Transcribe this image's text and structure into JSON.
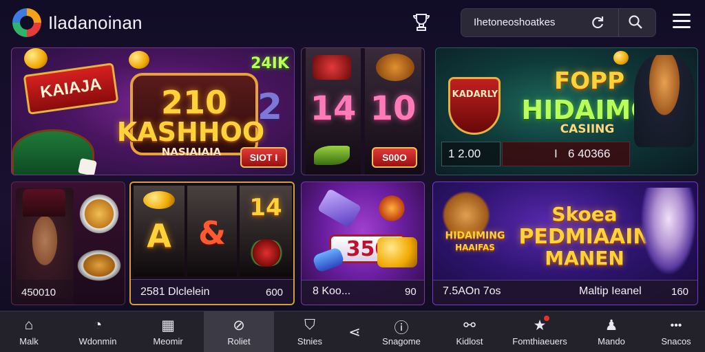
{
  "header": {
    "brand": "Iladanoinan",
    "logo_icon": "brand-logo",
    "trophy_icon": "trophy-icon",
    "search": {
      "value": "Ihetoneoshoatkes",
      "refresh_icon": "refresh-icon",
      "search_icon": "search-icon"
    },
    "menu_icon": "hamburger-menu-icon"
  },
  "tiles": {
    "t1": {
      "sign": "KAIAJA",
      "title_num": "210",
      "title": "KASHHOO",
      "subtitle": "NASIAIAIA",
      "badge": "24IK",
      "num": "2",
      "button": "SIOT I"
    },
    "t2": {
      "left_num": "14",
      "right_num": "10",
      "button": "S00O"
    },
    "t3": {
      "shield": "KADARLY",
      "title_top": "FOPP",
      "title": "HIDAIMO",
      "subtitle": "CASIING",
      "val_left": "1 2.00",
      "val_right": "6 40366",
      "sep": "I"
    },
    "t4": {
      "caption": "450010"
    },
    "t5": {
      "reel_left": "A",
      "reel_mid": "&",
      "reel_right": "14",
      "caption": "2581 Dlclelein",
      "caption_right": "600"
    },
    "t6": {
      "banner": "350",
      "caption": "8 Koo...",
      "caption_right": "90"
    },
    "t7": {
      "tag": "HIDAIMING",
      "tag2": "HAAIFAS",
      "title_top": "Skoea",
      "title": "PEDMIAAIN",
      "title_bottom": "MANEN",
      "caption": "7.5AOn 7os",
      "caption_mid": "Maltip Ieanel",
      "caption_right": "160"
    }
  },
  "nav": [
    {
      "icon": "home-icon",
      "glyph": "⌂",
      "label": "Malk"
    },
    {
      "icon": "timer-icon",
      "glyph": "◔",
      "label": "Wdonmin"
    },
    {
      "icon": "grid-icon",
      "glyph": "▦",
      "label": "Meomir"
    },
    {
      "icon": "compass-icon",
      "glyph": "⊘",
      "label": "Roliet"
    },
    {
      "icon": "basket-icon",
      "glyph": "⛉",
      "label": "Stnies"
    },
    {
      "icon": "share-icon",
      "glyph": "⋖",
      "label": ""
    },
    {
      "icon": "info-icon",
      "glyph": "ⓘ",
      "label": "Snagome"
    },
    {
      "icon": "link-icon",
      "glyph": "⚯",
      "label": "Kidlost"
    },
    {
      "icon": "star-icon",
      "glyph": "★",
      "label": "Fomthiaeuers"
    },
    {
      "icon": "user-icon",
      "glyph": "♟",
      "label": "Mando"
    },
    {
      "icon": "more-icon",
      "glyph": "•••",
      "label": "Snacos"
    }
  ],
  "colors": {
    "accent_purple": "#8a3cff",
    "gold": "#ffd23a",
    "nav_bg": "#232129"
  }
}
